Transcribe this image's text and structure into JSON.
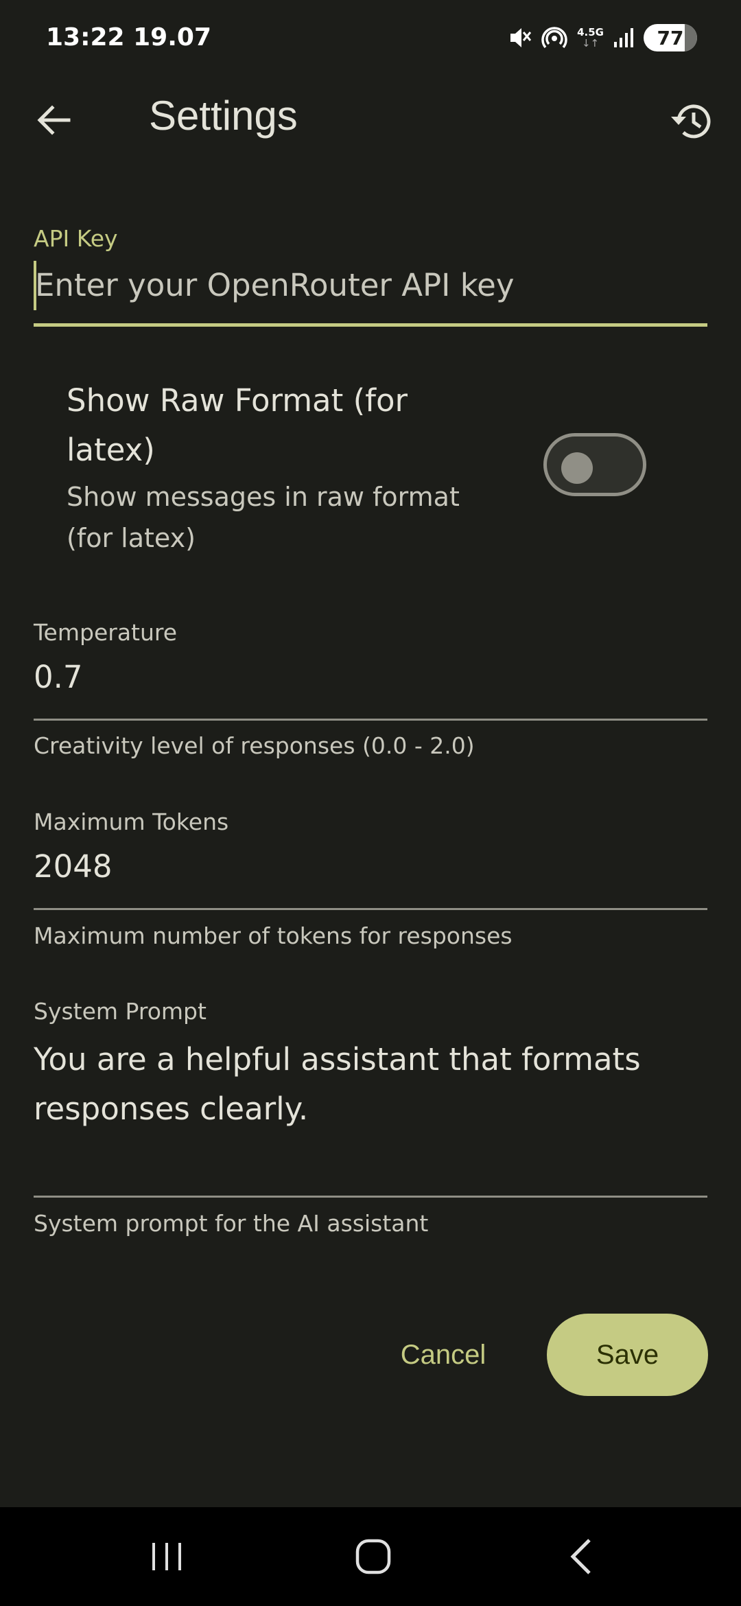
{
  "status_bar": {
    "time_date": "13:22  19.07",
    "network_label": "4.5G",
    "battery_level": "77",
    "battery_fraction": 0.77
  },
  "app_bar": {
    "title": "Settings",
    "back_icon": "arrow-back-icon",
    "history_icon": "history-icon"
  },
  "api_key": {
    "label": "API Key",
    "value": "",
    "placeholder": "Enter your OpenRouter API key"
  },
  "raw_format": {
    "title": "Show Raw Format (for latex)",
    "subtitle": "Show messages in raw format (for latex)",
    "enabled": false
  },
  "temperature": {
    "label": "Temperature",
    "value": "0.7",
    "helper": "Creativity level of responses (0.0 - 2.0)"
  },
  "max_tokens": {
    "label": "Maximum Tokens",
    "value": "2048",
    "helper": "Maximum number of tokens for responses"
  },
  "system_prompt": {
    "label": "System Prompt",
    "value": "You are a helpful assistant that formats responses clearly.",
    "helper": "System prompt for the AI assistant"
  },
  "actions": {
    "cancel_label": "Cancel",
    "save_label": "Save"
  },
  "colors": {
    "background": "#1c1d19",
    "accent": "#c5cb83",
    "text": "#e4e3d9"
  },
  "nav_bar": {
    "recents_icon": "recents-icon",
    "home_icon": "home-icon",
    "back_icon": "nav-back-icon"
  }
}
